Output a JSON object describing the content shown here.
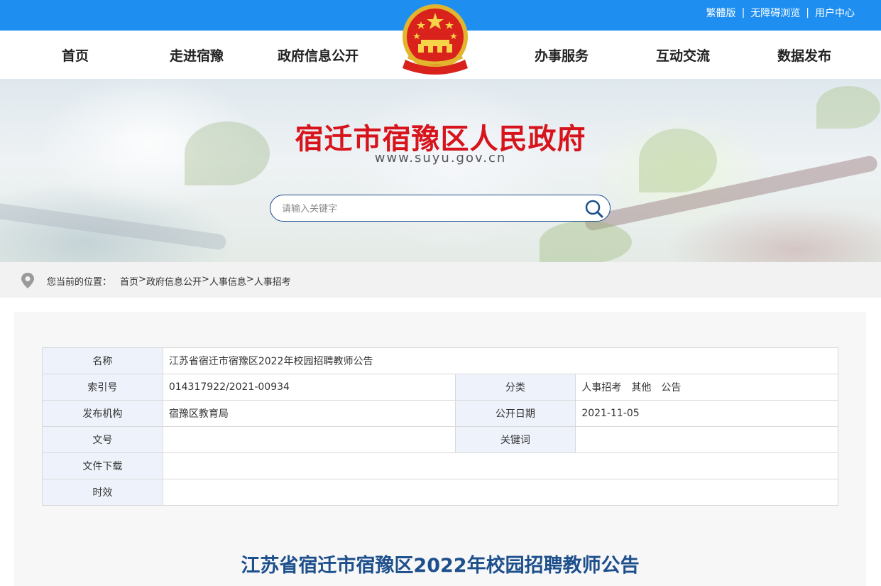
{
  "topbar": {
    "links": [
      "繁體版",
      "无障碍浏览",
      "用户中心"
    ],
    "separator": "|"
  },
  "nav": {
    "items": [
      "首页",
      "走进宿豫",
      "政府信息公开",
      "办事服务",
      "互动交流",
      "数据发布"
    ]
  },
  "banner": {
    "title": "宿迁市宿豫区人民政府",
    "url": "www.suyu.gov.cn",
    "search_placeholder": "请输入关键字"
  },
  "breadcrumb": {
    "label": "您当前的位置：",
    "items": [
      "首页",
      "政府信息公开",
      "人事信息",
      "人事招考"
    ],
    "separator": ">"
  },
  "meta_table": {
    "name_label": "名称",
    "name_value": "江苏省宿迁市宿豫区2022年校园招聘教师公告",
    "index_label": "索引号",
    "index_value": "014317922/2021-00934",
    "category_label": "分类",
    "category_values": [
      "人事招考",
      "其他",
      "公告"
    ],
    "publisher_label": "发布机构",
    "publisher_value": "宿豫区教育局",
    "date_label": "公开日期",
    "date_value": "2021-11-05",
    "docno_label": "文号",
    "docno_value": "",
    "keywords_label": "关键词",
    "keywords_value": "",
    "download_label": "文件下载",
    "download_value": "",
    "validity_label": "时效",
    "validity_value": ""
  },
  "article": {
    "title": "江苏省宿迁市宿豫区2022年校园招聘教师公告"
  },
  "colors": {
    "topbar": "#1e8ff0",
    "site_title": "#d7141c",
    "article_title": "#1d4f8c",
    "label_cell_bg": "#eef3fb"
  },
  "icons": {
    "emblem": "national-emblem-icon",
    "search": "search-icon",
    "location": "location-pin-icon"
  }
}
